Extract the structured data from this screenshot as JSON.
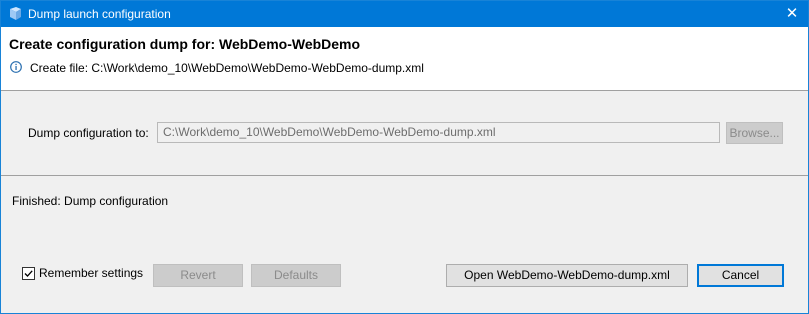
{
  "window": {
    "title": "Dump launch configuration",
    "close_glyph": "✕",
    "accent_color": "#0078d7"
  },
  "header": {
    "title": "Create configuration dump for: WebDemo-WebDemo",
    "info_icon": "info-icon",
    "info_text": "Create file: C:\\Work\\demo_10\\WebDemo\\WebDemo-WebDemo-dump.xml"
  },
  "dump": {
    "label": "Dump configuration to:",
    "value": "C:\\Work\\demo_10\\WebDemo\\WebDemo-WebDemo-dump.xml",
    "browse_label": "Browse..."
  },
  "status": {
    "text": "Finished: Dump configuration"
  },
  "footer": {
    "remember_label": "Remember settings",
    "remember_checked": true,
    "revert_label": "Revert",
    "defaults_label": "Defaults",
    "open_label": "Open WebDemo-WebDemo-dump.xml",
    "cancel_label": "Cancel"
  }
}
